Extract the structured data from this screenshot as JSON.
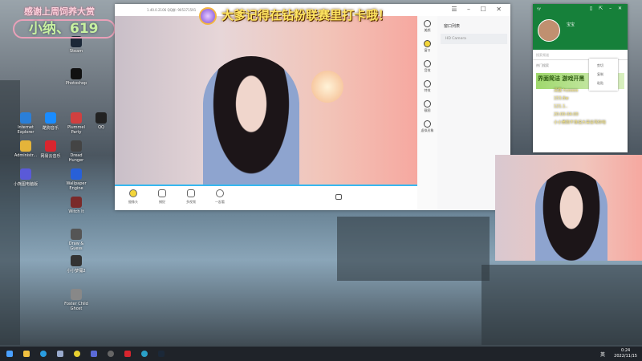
{
  "overlay": {
    "thanks": "感谢上周饲养大赏",
    "name": "小纳、619"
  },
  "desktop_icons": [
    {
      "label": "Internet Explorer",
      "color": "#2a7fd8"
    },
    {
      "label": "酷狗音乐",
      "color": "#1a8cff"
    },
    {
      "label": "Plummel Party",
      "color": "#d04040"
    },
    {
      "label": "QQ",
      "color": "#222"
    },
    {
      "label": "Administr...",
      "color": "#e4b43a"
    },
    {
      "label": "网易云音乐",
      "color": "#d8252e"
    },
    {
      "label": "Dread Hunger",
      "color": "#444"
    },
    {
      "label": "小熊图电脑版",
      "color": "#5a5ad8"
    },
    {
      "label": "Wallpaper Engine",
      "color": "#2860d8"
    },
    {
      "label": "Witch It",
      "color": "#7a2a2a"
    },
    {
      "label": "Draw & Guess",
      "color": "#555"
    },
    {
      "label": "小小梦魇2",
      "color": "#333"
    },
    {
      "label": "Foster Child Ghost",
      "color": "#888"
    },
    {
      "label": "Steam",
      "color": "#1b2838"
    },
    {
      "label": "Photoshop",
      "color": "#111"
    }
  ],
  "app": {
    "version": "1.40.0.2106  QQ群: 905371591",
    "banner": "大爹记得在钻粉联赛里打卡哦！",
    "toolbar": [
      "摄像头",
      "捕捉",
      "多视频",
      "一起看"
    ],
    "rail": [
      "美颜",
      "窗口",
      "音效",
      "特效",
      "截图",
      "虚拟形象"
    ],
    "panel_title": "窗口列表",
    "source": "HD Camera"
  },
  "yy": {
    "logo": "YY",
    "name": "宝宝",
    "search_placeholder": "搜索频道",
    "hot": "热门搜索",
    "ad": "界面简洁 游戏开黑",
    "context_menu": [
      "剪切",
      "复制",
      "粘贴"
    ]
  },
  "gifts": [
    "清露 huaaaa",
    "153.8w",
    "121.1..",
    "20:00-04:00",
    "小小黄狗不准说大哥会骂你哈"
  ],
  "taskbar": {
    "time": "0:24",
    "date": "2022/11/15",
    "lang": "英"
  }
}
